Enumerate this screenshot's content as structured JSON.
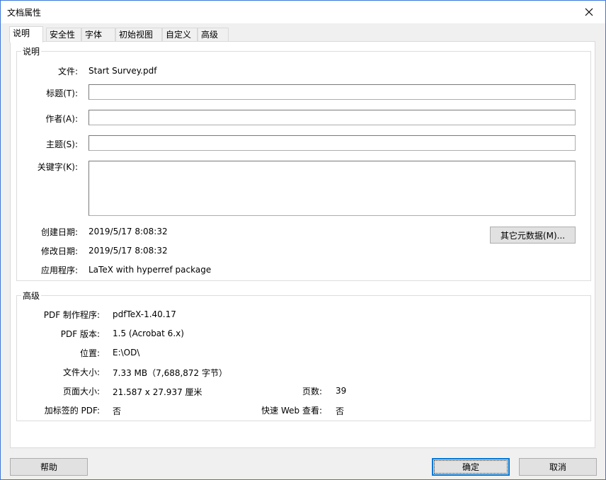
{
  "window": {
    "title": "文档属性"
  },
  "tabs": [
    {
      "label": "说明"
    },
    {
      "label": "安全性"
    },
    {
      "label": "字体"
    },
    {
      "label": "初始视图"
    },
    {
      "label": "自定义"
    },
    {
      "label": "高级"
    }
  ],
  "description": {
    "legend": "说明",
    "file_label": "文件:",
    "file_value": "Start Survey.pdf",
    "title_label": "标题(T):",
    "title_value": "",
    "author_label": "作者(A):",
    "author_value": "",
    "subject_label": "主题(S):",
    "subject_value": "",
    "keywords_label": "关键字(K):",
    "keywords_value": "",
    "created_label": "创建日期:",
    "created_value": "2019/5/17 8:08:32",
    "modified_label": "修改日期:",
    "modified_value": "2019/5/17 8:08:32",
    "app_label": "应用程序:",
    "app_value": "LaTeX with hyperref package",
    "metadata_button": "其它元数据(M)..."
  },
  "advanced": {
    "legend": "高级",
    "producer_label": "PDF 制作程序:",
    "producer_value": "pdfTeX-1.40.17",
    "version_label": "PDF 版本:",
    "version_value": "1.5 (Acrobat 6.x)",
    "location_label": "位置:",
    "location_value": "E:\\OD\\",
    "size_label": "文件大小:",
    "size_value": "7.33 MB（7,688,872 字节）",
    "pagesize_label": "页面大小:",
    "pagesize_value": "21.587 x 27.937 厘米",
    "pages_label": "页数:",
    "pages_value": "39",
    "tagged_label": "加标签的 PDF:",
    "tagged_value": "否",
    "fastweb_label": "快速 Web 查看:",
    "fastweb_value": "否"
  },
  "buttons": {
    "help": "帮助",
    "ok": "确定",
    "cancel": "取消"
  }
}
